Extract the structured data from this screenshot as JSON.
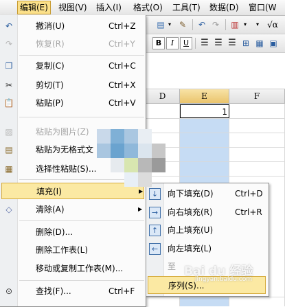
{
  "menubar": {
    "items": [
      "编辑(E)",
      "视图(V)",
      "插入(I)",
      "格式(O)",
      "工具(T)",
      "数据(D)",
      "窗口(W"
    ]
  },
  "toolbar": {
    "font_bold": "B",
    "font_italic": "I",
    "font_underline": "U",
    "formula_symbol": "√α"
  },
  "sheet": {
    "columns": [
      "D",
      "E",
      "F"
    ],
    "selected_column": "E",
    "cell_E1_value": "1"
  },
  "edit_menu": {
    "items": [
      {
        "label": "撤消(U)",
        "shortcut": "Ctrl+Z",
        "icon": "undo-icon",
        "disabled": false
      },
      {
        "label": "恢复(R)",
        "shortcut": "Ctrl+Y",
        "icon": "redo-icon",
        "disabled": true
      },
      {
        "label": "复制(C)",
        "shortcut": "Ctrl+C",
        "icon": "copy-icon",
        "disabled": false
      },
      {
        "label": "剪切(T)",
        "shortcut": "Ctrl+X",
        "icon": "cut-icon",
        "disabled": false
      },
      {
        "label": "粘贴(P)",
        "shortcut": "Ctrl+V",
        "icon": "paste-icon",
        "disabled": false
      },
      {
        "label": "粘贴为图片(Z)",
        "shortcut": "",
        "icon": "paste-picture-icon",
        "disabled": true
      },
      {
        "label": "粘贴为无格式文",
        "shortcut": "",
        "icon": "paste-plain-icon",
        "disabled": false
      },
      {
        "label": "选择性粘贴(S)...",
        "shortcut": "",
        "icon": "paste-special-icon",
        "disabled": false
      },
      {
        "label": "填充(I)",
        "shortcut": "",
        "icon": "",
        "disabled": false,
        "has_submenu": true
      },
      {
        "label": "清除(A)",
        "shortcut": "",
        "icon": "eraser-icon",
        "disabled": false,
        "has_submenu": true
      },
      {
        "label": "删除(D)...",
        "shortcut": "",
        "icon": "",
        "disabled": false
      },
      {
        "label": "删除工作表(L)",
        "shortcut": "",
        "icon": "",
        "disabled": false
      },
      {
        "label": "移动或复制工作表(M)...",
        "shortcut": "",
        "icon": "",
        "disabled": false
      },
      {
        "label": "查找(F)...",
        "shortcut": "Ctrl+F",
        "icon": "binoculars-icon",
        "disabled": false
      }
    ]
  },
  "fill_submenu": {
    "items": [
      {
        "label": "向下填充(D)",
        "shortcut": "Ctrl+D",
        "icon": "fill-down-icon",
        "disabled": false
      },
      {
        "label": "向右填充(R)",
        "shortcut": "Ctrl+R",
        "icon": "fill-right-icon",
        "disabled": false
      },
      {
        "label": "向上填充(U)",
        "shortcut": "",
        "icon": "fill-up-icon",
        "disabled": false
      },
      {
        "label": "向左填充(L)",
        "shortcut": "",
        "icon": "fill-left-icon",
        "disabled": false
      },
      {
        "label": "至",
        "shortcut": "",
        "icon": "",
        "disabled": true
      },
      {
        "label": "序列(S)...",
        "shortcut": "",
        "icon": "",
        "disabled": false
      }
    ]
  },
  "watermark": {
    "text": "Bai du 经验",
    "url": "jingyan.baidu.com"
  },
  "colors": {
    "highlight": "#fbe9a3",
    "selection": "#c6dcf4",
    "disabled_text": "#a7a7a7"
  }
}
